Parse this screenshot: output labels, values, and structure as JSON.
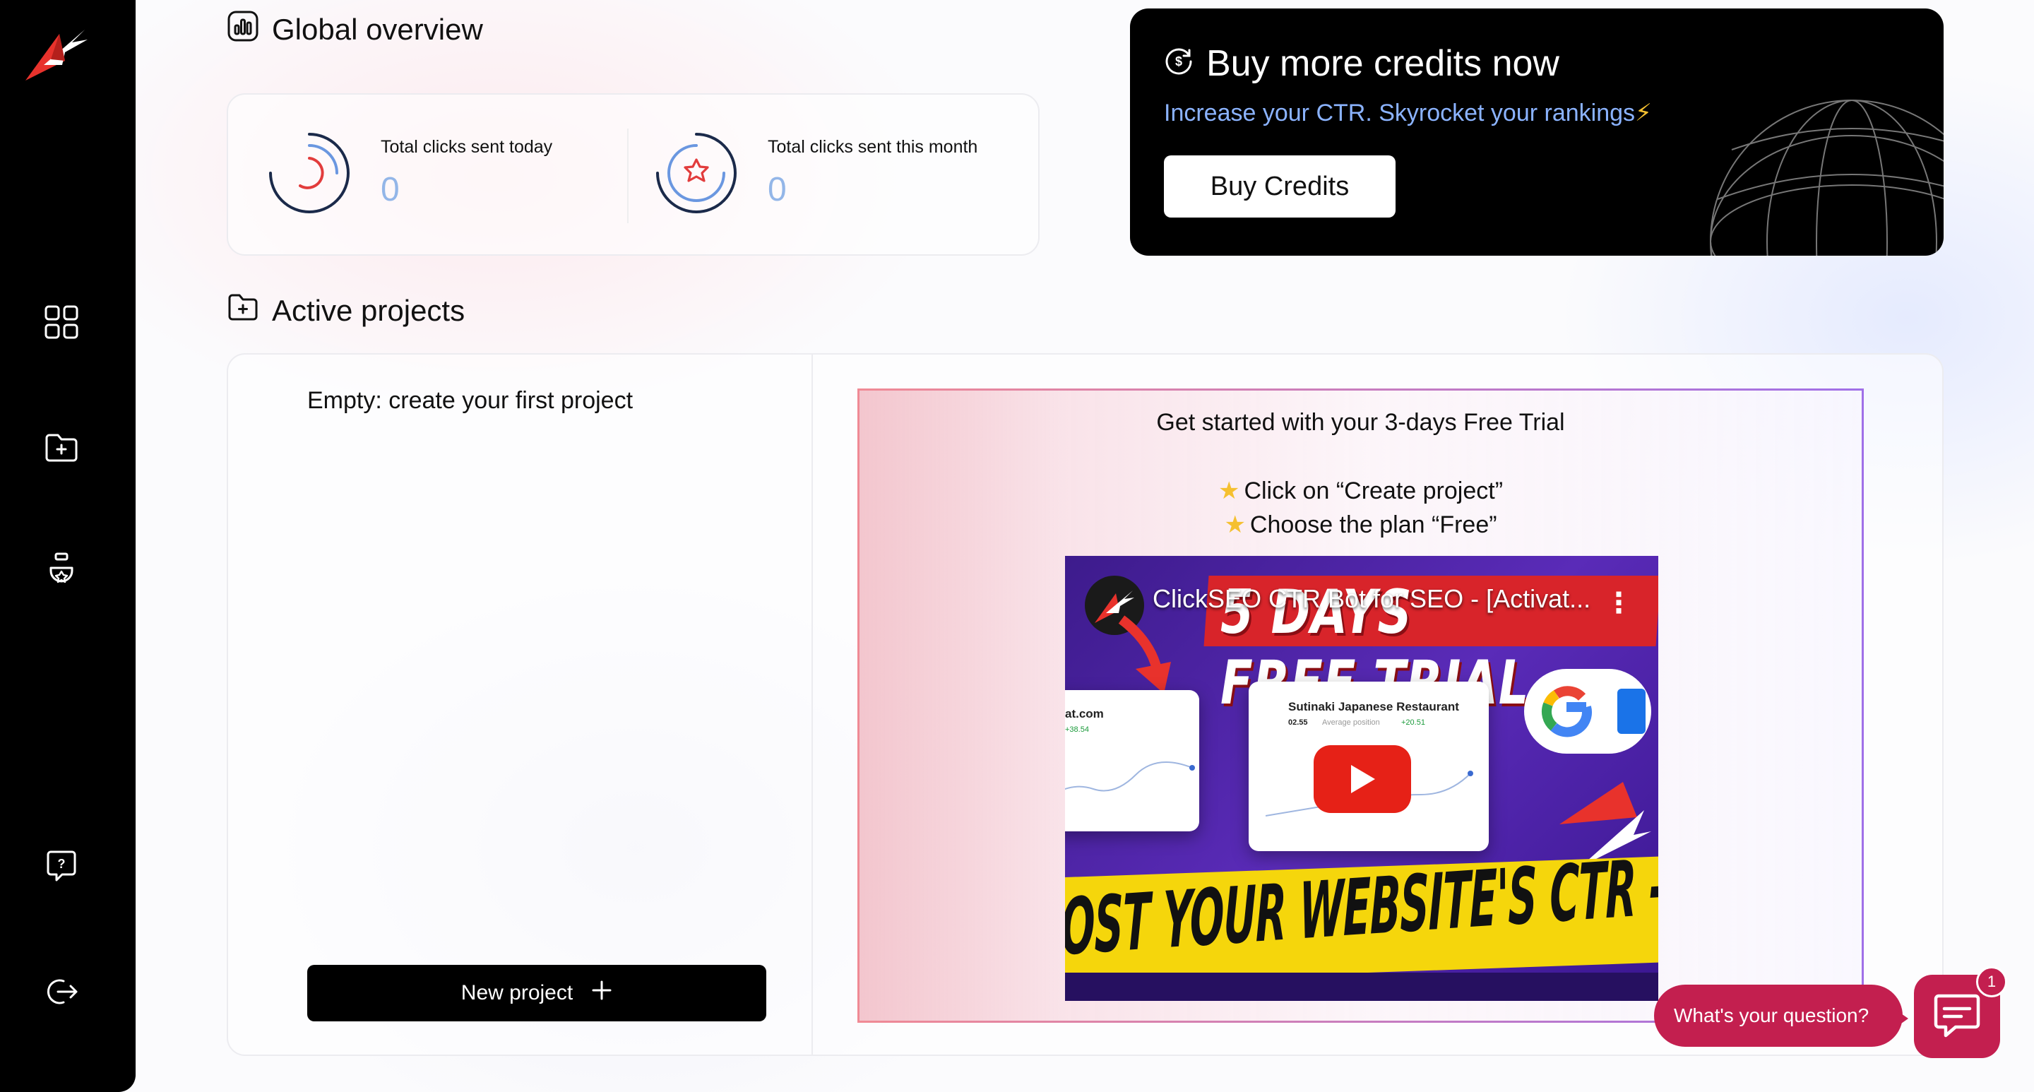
{
  "sidebar": {
    "logo_icon": "bird-arrow-logo",
    "items": [
      {
        "icon": "dashboard-grid-icon"
      },
      {
        "icon": "folder-add-icon"
      },
      {
        "icon": "settings-badge-icon"
      },
      {
        "icon": "help-chat-icon"
      },
      {
        "icon": "logout-icon"
      }
    ]
  },
  "overview": {
    "title": "Global overview",
    "stats": [
      {
        "label": "Total clicks sent today",
        "value": "0"
      },
      {
        "label": "Total clicks sent this month",
        "value": "0"
      }
    ]
  },
  "credits": {
    "title": "Buy more credits now",
    "subtitle": "Increase your CTR. Skyrocket your rankings",
    "subtitle_emoji": "⚡",
    "button_label": "Buy Credits"
  },
  "projects": {
    "title": "Active projects",
    "empty_text": "Empty: create your first project",
    "new_project_label": "New project",
    "trial": {
      "title": "Get started with your 3-days Free Trial",
      "steps": [
        "Click on “Create project”",
        "Choose the plan “Free”"
      ],
      "video": {
        "title": "ClickSEO CTR Bot for SEO - [Activat...",
        "banner_text": "5 DAYS FREE TRIAL",
        "bottom_text": "OST YOUR WEBSITE'S CTR - CLIMB SEO RANKI",
        "card_left_site": "at.com",
        "card_left_delta": "+38.54",
        "card_right_title": "Sutinaki Japanese Restaurant",
        "card_right_position": "02.55",
        "card_right_position_label": "Average position",
        "card_right_delta": "+20.51"
      }
    }
  },
  "chat": {
    "prompt": "What's your question?",
    "badge_count": "1"
  },
  "colors": {
    "accent_red": "#c31f4f",
    "stat_value_blue": "#93b6e8",
    "subtitle_blue": "#8bb3ff"
  }
}
